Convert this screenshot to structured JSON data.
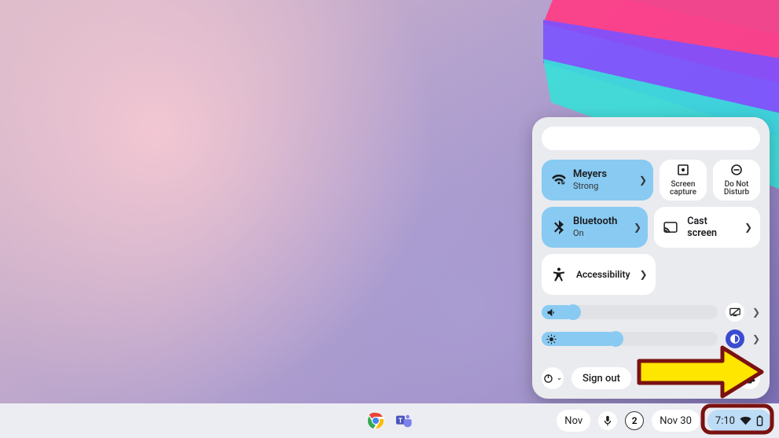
{
  "wifi": {
    "name": "Meyers",
    "signal": "Strong"
  },
  "bluetooth": {
    "label": "Bluetooth",
    "status": "On"
  },
  "quick_tiles": {
    "screen_capture": {
      "line1": "Screen",
      "line2": "capture"
    },
    "dnd": {
      "line1": "Do Not",
      "line2": "Disturb"
    },
    "cast": "Cast screen",
    "accessibility": "Accessibility"
  },
  "footer": {
    "sign_out": "Sign out"
  },
  "shelf": {
    "notif_count": "2",
    "month": "Nov",
    "date": "Nov 30",
    "time": "7:10"
  }
}
